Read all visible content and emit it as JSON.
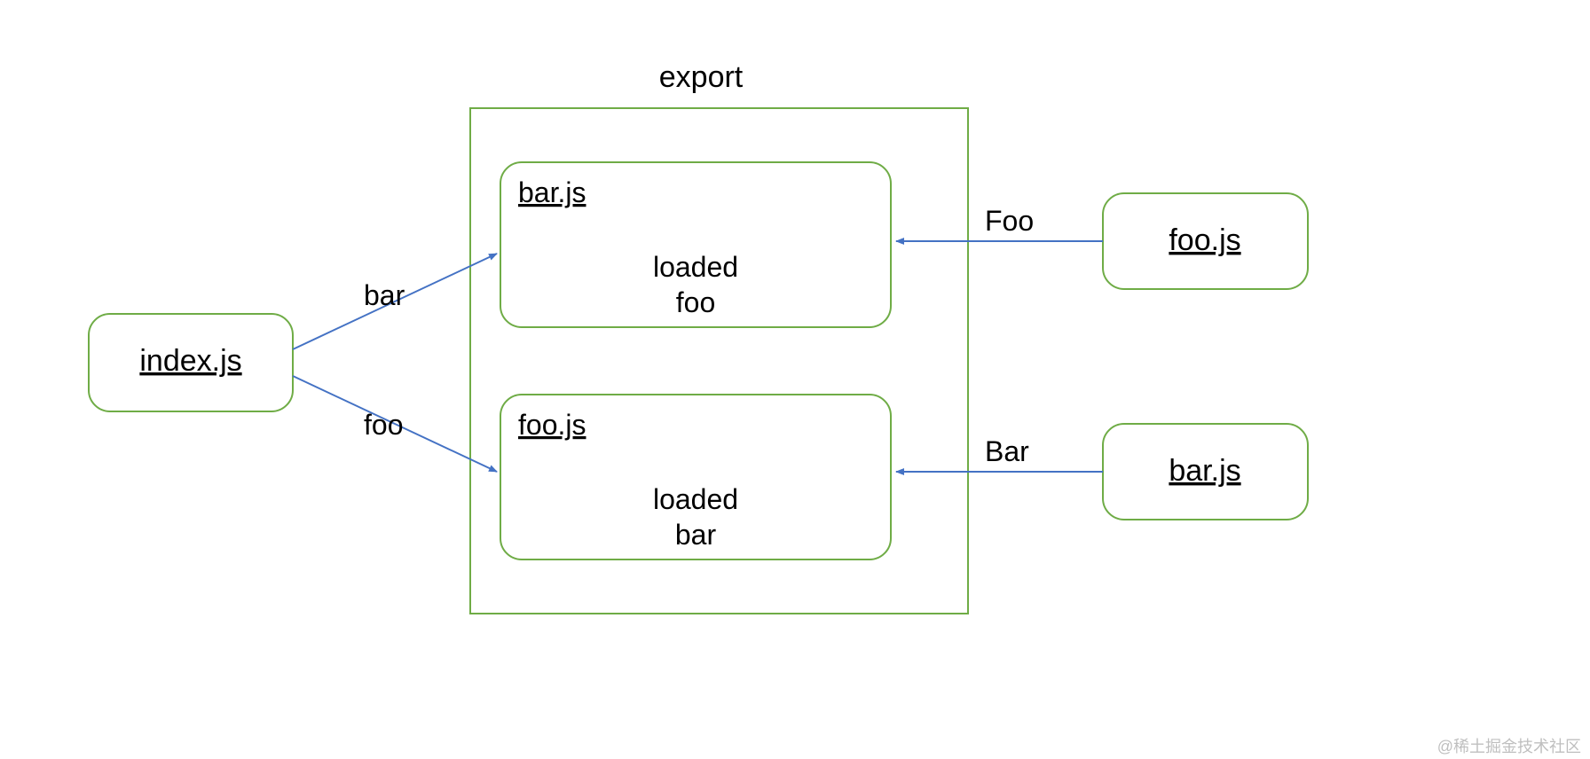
{
  "export_label": "export",
  "index_box_label": "index.js",
  "arrow_labels": {
    "bar": "bar",
    "foo": "foo",
    "Foo": "Foo",
    "Bar": "Bar"
  },
  "bar_js_box": {
    "title": "bar.js",
    "loaded": "loaded",
    "value": "foo"
  },
  "foo_js_box": {
    "title": "foo.js",
    "loaded": "loaded",
    "value": "bar"
  },
  "right_foo_box_label": "foo.js",
  "right_bar_box_label": "bar.js",
  "watermark": "@稀土掘金技术社区"
}
